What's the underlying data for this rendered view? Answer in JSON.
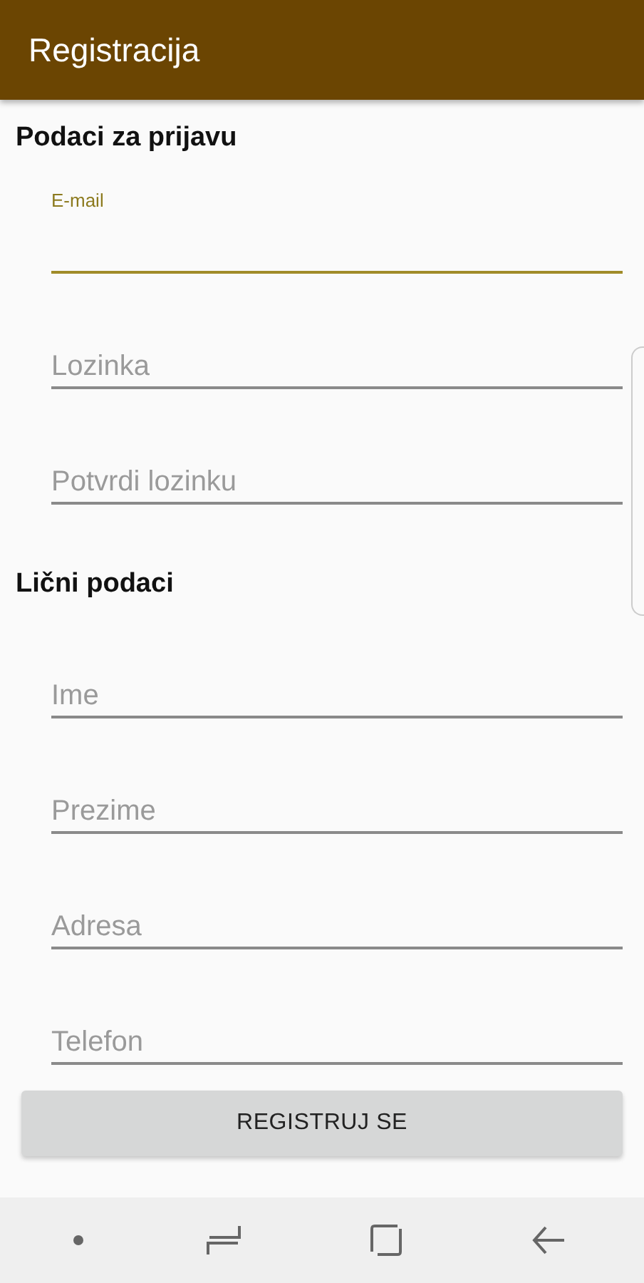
{
  "app_bar": {
    "title": "Registracija"
  },
  "sections": [
    {
      "heading": "Podaci za prijavu",
      "fields": [
        {
          "label": "E-mail",
          "focused": true
        },
        {
          "placeholder": "Lozinka",
          "focused": false
        },
        {
          "placeholder": "Potvrdi lozinku",
          "focused": false
        }
      ]
    },
    {
      "heading": "Lični podaci",
      "fields": [
        {
          "placeholder": "Ime",
          "focused": false
        },
        {
          "placeholder": "Prezime",
          "focused": false
        },
        {
          "placeholder": "Adresa",
          "focused": false
        },
        {
          "placeholder": "Telefon",
          "focused": false
        }
      ]
    }
  ],
  "submit_button": "REGISTRUJ SE"
}
